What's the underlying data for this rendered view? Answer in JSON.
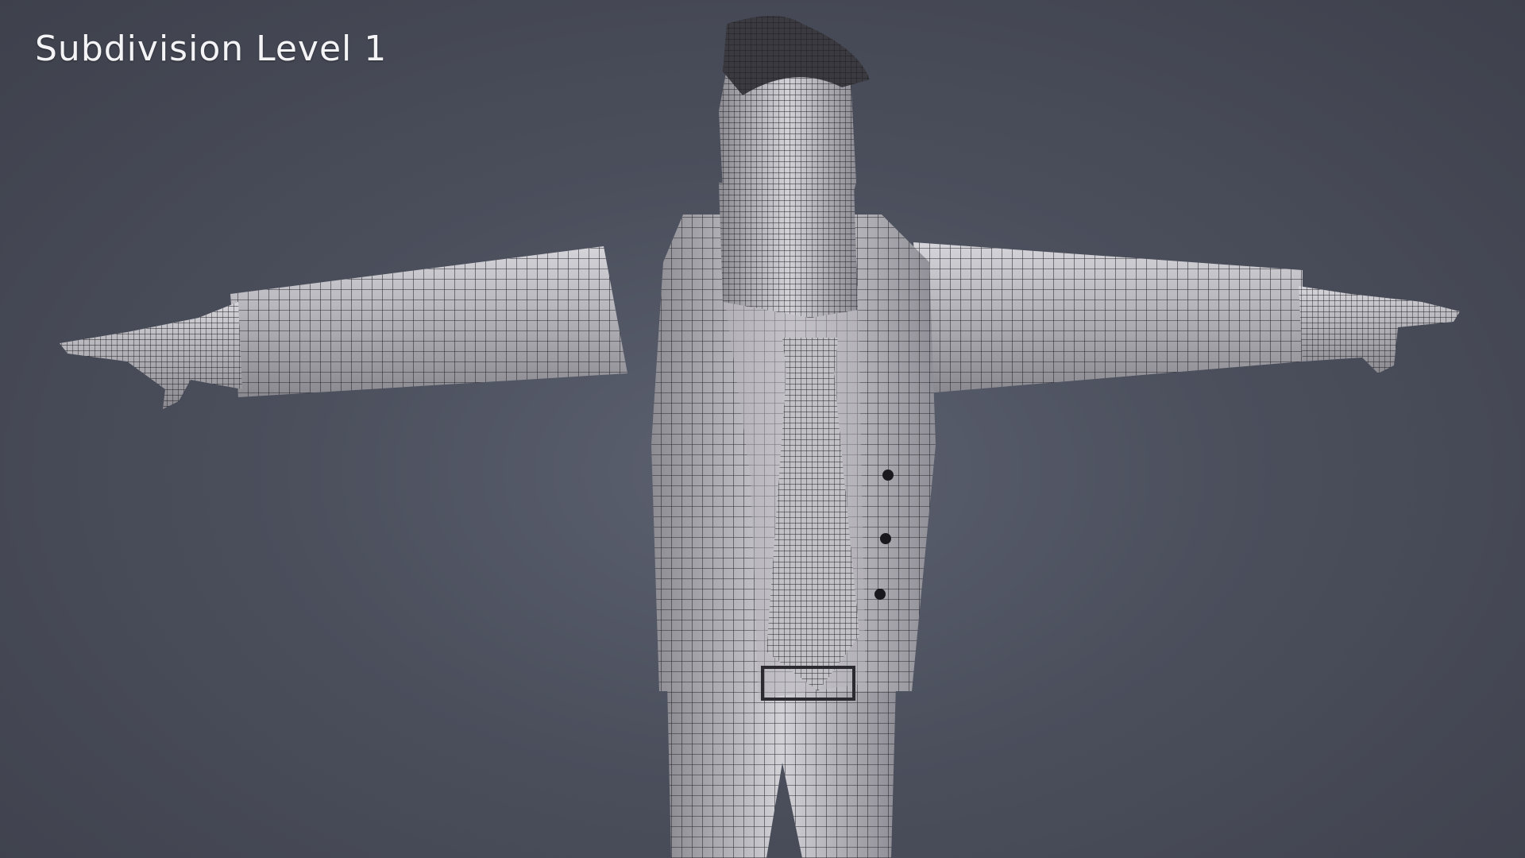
{
  "caption": "Subdivision Level 1",
  "colors": {
    "background": "#4b4f5c",
    "mesh_surface": "#bdbcc2",
    "wire": "#2a2a30"
  }
}
